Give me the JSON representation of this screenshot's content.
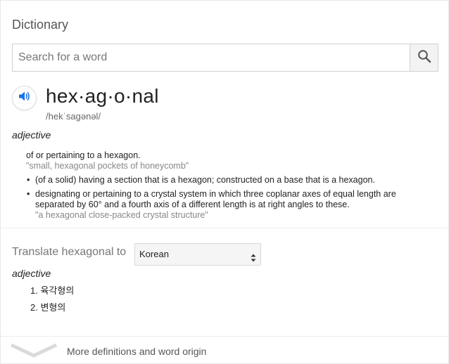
{
  "card": {
    "title": "Dictionary"
  },
  "search": {
    "placeholder": "Search for a word",
    "value": "",
    "button_icon": "search-icon"
  },
  "entry": {
    "word": "hex·ag·o·nal",
    "phonetic": "/hekˈsagənəl/",
    "audio_icon": "speaker-icon",
    "senses": [
      {
        "part_of_speech": "adjective",
        "definition": "of or pertaining to a hexagon.",
        "example": "\"small, hexagonal pockets of honeycomb\"",
        "subdefinitions": [
          {
            "text": "(of a solid) having a section that is a hexagon; constructed on a base that is a hexagon.",
            "example": ""
          },
          {
            "text": "designating or pertaining to a crystal system in which three coplanar axes of equal length are separated by 60° and a fourth axis of a different length is at right angles to these.",
            "example": "\"a hexagonal close-packed crystal structure\""
          }
        ]
      }
    ]
  },
  "translate": {
    "label": "Translate hexagonal to",
    "selected_language": "Korean",
    "part_of_speech": "adjective",
    "items": [
      "1. 육각형의",
      "2. 변형의"
    ]
  },
  "footer": {
    "more_label": "More definitions and word origin",
    "chevron_icon": "chevron-down-icon"
  },
  "colors": {
    "accent": "#1a73e8",
    "text": "#222222",
    "muted": "#878787"
  }
}
